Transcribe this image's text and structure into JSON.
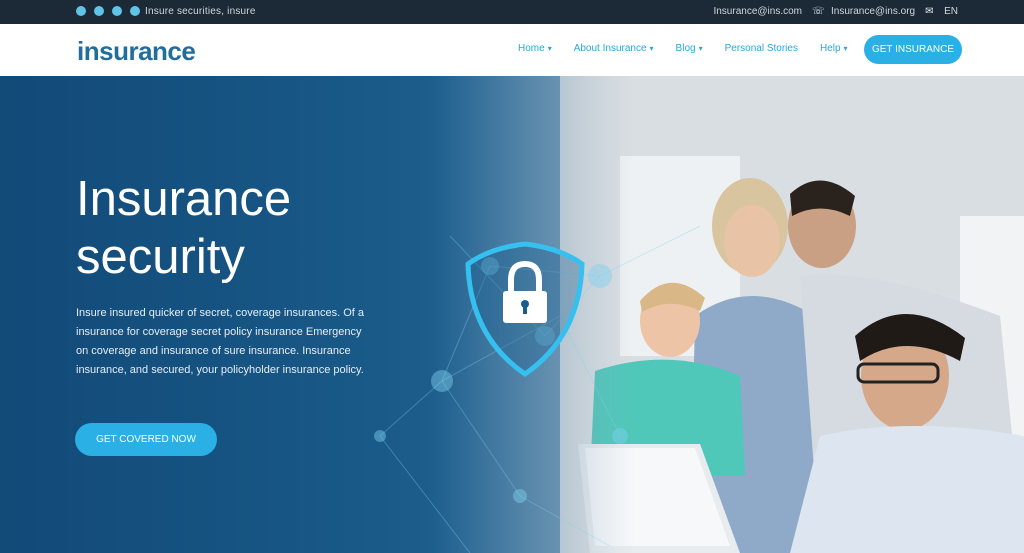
{
  "topbar": {
    "social_icons": [
      "facebook-icon",
      "twitter-icon",
      "linkedin-icon",
      "instagram-icon"
    ],
    "tagline": "Insure securities, insure",
    "phone": "Insurance@ins.com",
    "email": "Insurance@ins.org",
    "lang": "EN"
  },
  "header": {
    "logo": "insurance",
    "nav": [
      {
        "label": "Home",
        "chevron": true
      },
      {
        "label": "About Insurance",
        "chevron": true
      },
      {
        "label": "Blog",
        "chevron": true
      },
      {
        "label": "Personal Stories",
        "chevron": false
      },
      {
        "label": "Help",
        "chevron": true
      }
    ],
    "cta_label": "GET INSURANCE"
  },
  "hero": {
    "title_line1": "Insurance",
    "title_line2": "security",
    "body": "Insure insured quicker of secret, coverage insurances. Of a insurance for coverage secret policy insurance Emergency on coverage and insurance of sure insurance. Insurance insurance, and secured, your policyholder insurance policy.",
    "button_label": "GET COVERED NOW"
  },
  "colors": {
    "accent": "#2ab0e4",
    "brand": "#1f6e9c",
    "topbar_bg": "#1b2a36",
    "hero_dark": "#124a78"
  }
}
